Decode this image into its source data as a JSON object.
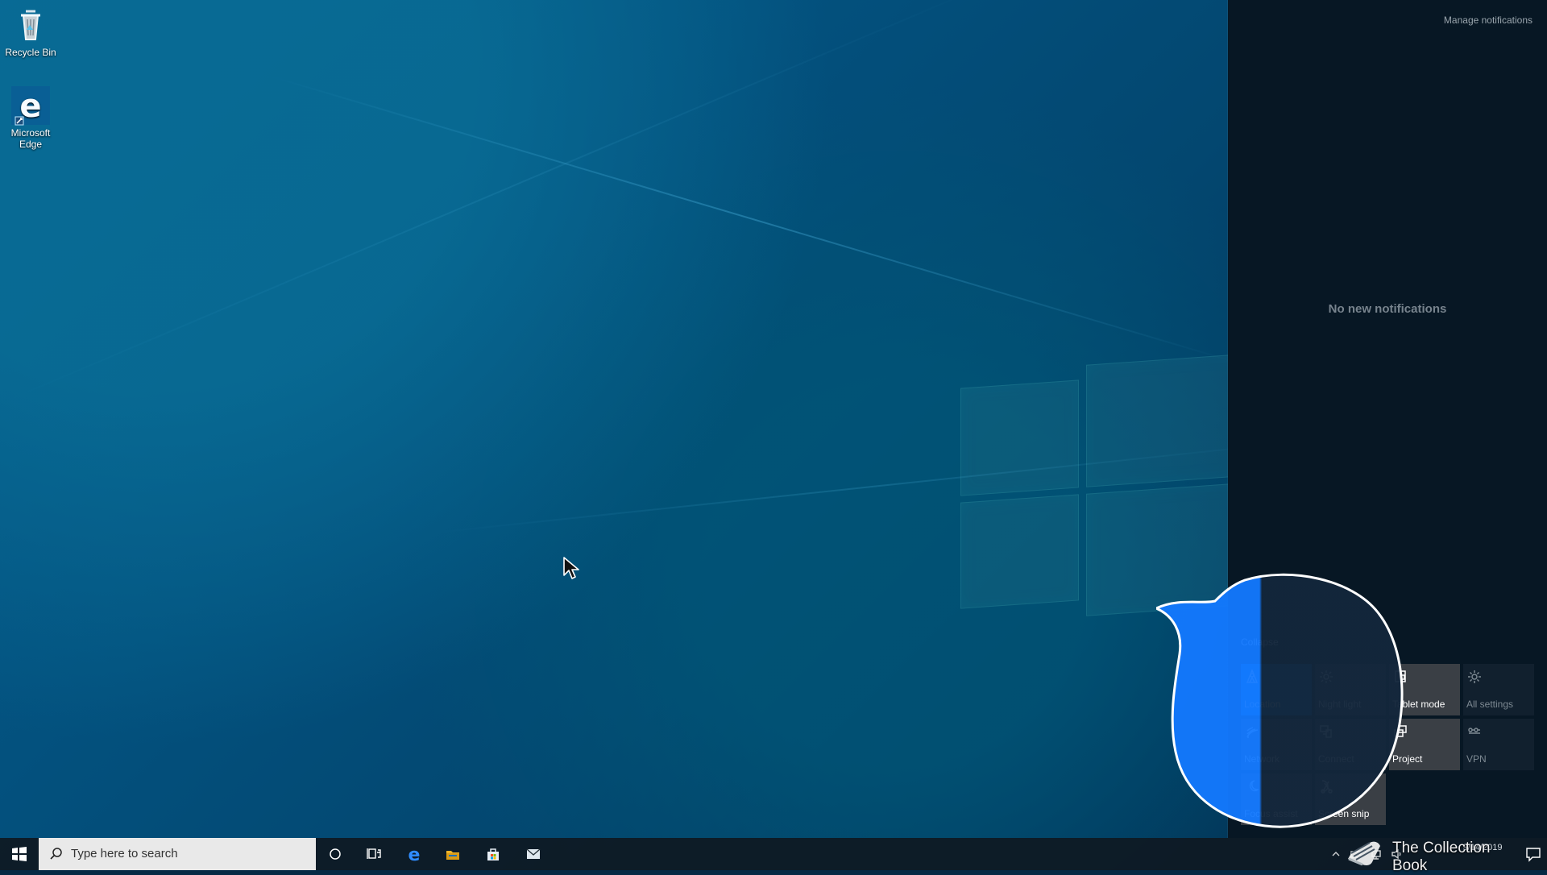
{
  "desktop": {
    "icons": [
      {
        "label": "Recycle Bin",
        "icon": "recycle-bin-icon"
      },
      {
        "label": "Microsoft Edge",
        "icon": "microsoft-edge-icon"
      }
    ]
  },
  "action_center": {
    "manage_link": "Manage notifications",
    "empty_state": "No new notifications",
    "collapse_label": "Collapse",
    "quick_actions": [
      {
        "label": "Location",
        "icon": "location-icon",
        "state": "active"
      },
      {
        "label": "Night light",
        "icon": "night-light-icon",
        "state": "normal"
      },
      {
        "label": "Tablet mode",
        "icon": "tablet-mode-icon",
        "state": "normal"
      },
      {
        "label": "All settings",
        "icon": "settings-icon",
        "state": "dim"
      },
      {
        "label": "Network",
        "icon": "network-icon",
        "state": "normal"
      },
      {
        "label": "Connect",
        "icon": "connect-icon",
        "state": "normal"
      },
      {
        "label": "Project",
        "icon": "project-icon",
        "state": "normal"
      },
      {
        "label": "VPN",
        "icon": "vpn-icon",
        "state": "dim"
      },
      {
        "label": "Focus assist",
        "icon": "focus-assist-icon",
        "state": "normal"
      },
      {
        "label": "Screen snip",
        "icon": "screen-snip-icon",
        "state": "normal"
      }
    ]
  },
  "taskbar": {
    "search_placeholder": "Type here to search",
    "items": [
      {
        "name": "Start",
        "icon": "windows-start-icon"
      },
      {
        "name": "Cortana",
        "icon": "cortana-icon"
      },
      {
        "name": "Task View",
        "icon": "task-view-icon"
      },
      {
        "name": "Microsoft Edge",
        "icon": "edge-icon"
      },
      {
        "name": "File Explorer",
        "icon": "file-explorer-icon"
      },
      {
        "name": "Microsoft Store",
        "icon": "store-icon"
      },
      {
        "name": "Mail",
        "icon": "mail-icon"
      }
    ],
    "tray": {
      "date": "9/14/2019",
      "notification_icon": "notification-icon"
    }
  },
  "watermark": {
    "text": "The Collection Book",
    "icon": "book-logo-icon"
  },
  "colors": {
    "action_center_background": "#071724",
    "active_tile": "#0078d7",
    "tile": "#3a3f45",
    "taskbar": "#0e1923",
    "bubble_highlight": "#1e90ff"
  }
}
